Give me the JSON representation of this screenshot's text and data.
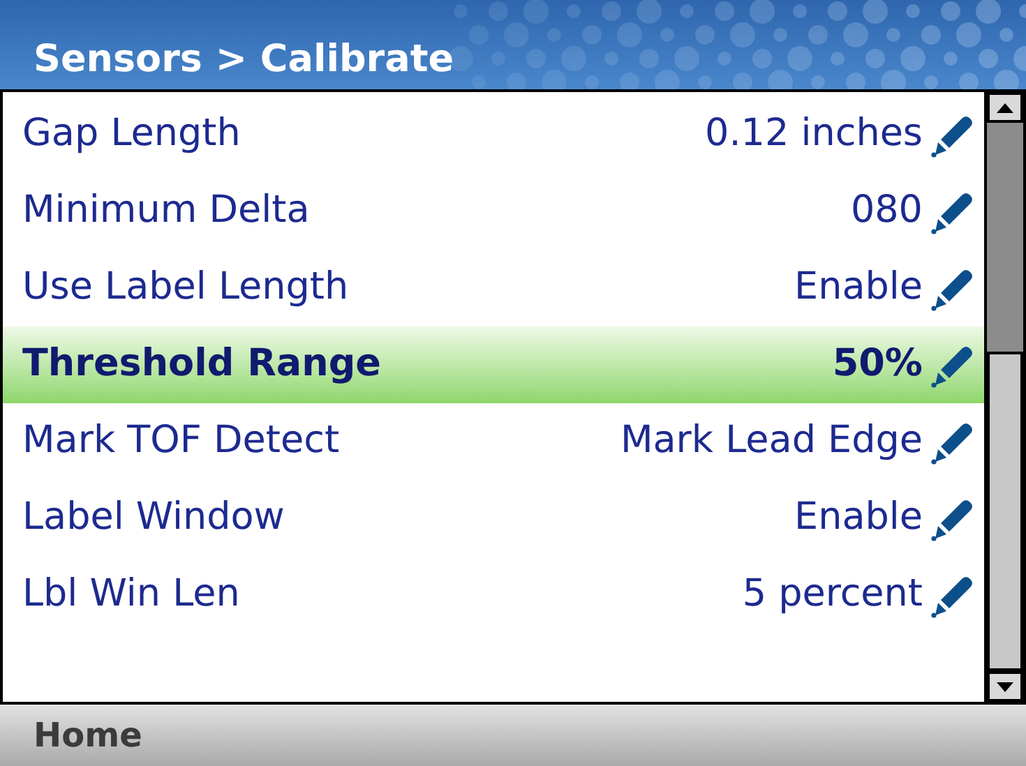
{
  "header": {
    "title": "Sensors > Calibrate"
  },
  "settings": [
    {
      "label": "Gap Length",
      "value": "0.12 inches",
      "selected": false
    },
    {
      "label": "Minimum Delta",
      "value": "080",
      "selected": false
    },
    {
      "label": "Use Label Length",
      "value": "Enable",
      "selected": false
    },
    {
      "label": "Threshold Range",
      "value": "50%",
      "selected": true
    },
    {
      "label": "Mark TOF Detect",
      "value": "Mark Lead Edge",
      "selected": false
    },
    {
      "label": "Label Window",
      "value": "Enable",
      "selected": false
    },
    {
      "label": "Lbl Win Len",
      "value": "5 percent",
      "selected": false
    }
  ],
  "footer": {
    "label": "Home"
  }
}
